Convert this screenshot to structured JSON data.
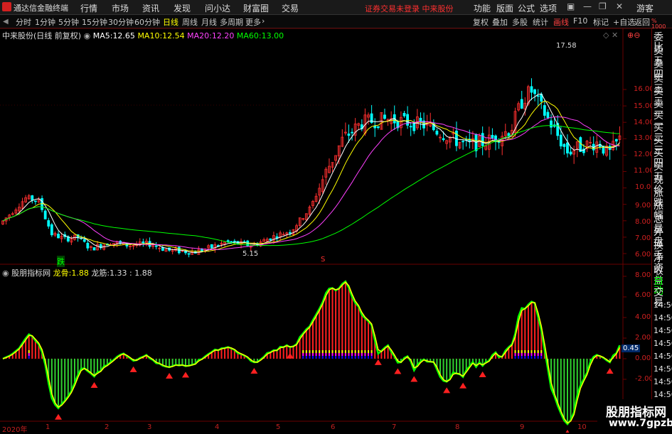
{
  "app": {
    "title": "通达信金融终端",
    "login_status": "证券交易未登录  中来股份"
  },
  "menu": [
    "行情",
    "市场",
    "资讯",
    "发现",
    "问小达",
    "财富圈",
    "交易"
  ],
  "right_menu": [
    "功能",
    "版面",
    "公式",
    "选项",
    "游客"
  ],
  "periods": [
    "分时",
    "1分钟",
    "5分钟",
    "15分钟",
    "30分钟",
    "60分钟",
    "日线",
    "周线",
    "月线",
    "多周期",
    "更多"
  ],
  "active_period": "日线",
  "tools": [
    "复权",
    "叠加",
    "多股",
    "统计",
    "画线",
    "F10",
    "标记",
    "+自选",
    "返回"
  ],
  "main_chart": {
    "stock_label": "中来股份(日线 前复权)",
    "ma": [
      {
        "label": "MA5:",
        "value": "12.65",
        "color": "#ffffff"
      },
      {
        "label": "MA10:",
        "value": "12.54",
        "color": "#ffff00"
      },
      {
        "label": "MA20:",
        "value": "12.20",
        "color": "#ff40ff"
      },
      {
        "label": "MA60:",
        "value": "13.00",
        "color": "#00ff00"
      }
    ],
    "y_ticks": [
      "16.00",
      "15.00",
      "14.00",
      "13.00",
      "12.00",
      "11.00",
      "10.00",
      "9.00",
      "8.00",
      "7.00",
      "6.00"
    ],
    "high_label": "17.58",
    "low_label": "5.15",
    "mark_down": "跌",
    "mark_s": "S"
  },
  "sub_chart": {
    "indicator": "股朋指标网",
    "line1_label": "龙骨:",
    "line1_value": "1.88",
    "line2_label": "龙筋:",
    "line2_value": "1.33 : 1.88",
    "y_ticks": [
      "8.00",
      "6.00",
      "4.00",
      "2.00",
      "0.00",
      "-2.00"
    ],
    "current_value": "0.45"
  },
  "x_ticks": [
    "2020年",
    "1",
    "2",
    "3",
    "4",
    "5",
    "6",
    "7",
    "8",
    "9",
    "10"
  ],
  "right_panel": [
    "委比",
    "卖五",
    "卖四",
    "卖三",
    "卖二",
    "卖一",
    "买一",
    "买二",
    "买三",
    "买四",
    "买五",
    "现价",
    "涨跌",
    "涨幅",
    "总量",
    "外盘",
    "换手",
    "净资",
    "收益",
    "自动",
    "交易",
    "14:56",
    "14:56",
    "14:56",
    "14:56",
    "14:56",
    "14:56",
    "14:56",
    "14:56"
  ],
  "watermark": {
    "line1": "股朋指标网",
    "line2": "www.7gpzb.com"
  },
  "colors": {
    "up": "#ff3030",
    "down": "#00ffff",
    "ma5": "#ffffff",
    "ma10": "#ffff00",
    "ma20": "#ff40ff",
    "ma60": "#00ff00"
  }
}
